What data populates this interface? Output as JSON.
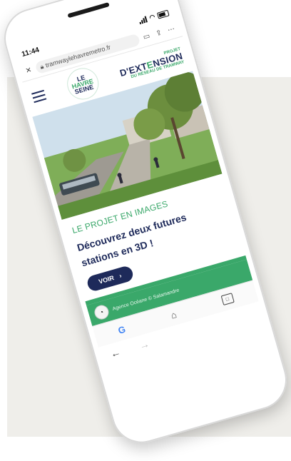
{
  "status": {
    "time": "11:44"
  },
  "browser": {
    "url": "tramwaylehavremetro.fr"
  },
  "site": {
    "logo_line1": "LE",
    "logo_line2": "HAVRE",
    "logo_line3": "SEINE",
    "projet_label": "PROJET",
    "extension_prefix": "D'EXT",
    "extension_accent": "E",
    "extension_suffix": "NSION",
    "reseau_label": "DU RÉSEAU DE TRAMWAY"
  },
  "card": {
    "kicker": "LE PROJET EN IMAGES",
    "headline": "Découvrez deux futures stations en 3D !",
    "button_label": "VOIR",
    "button_arrow": "›"
  },
  "footer": {
    "credit": "Agence Océane © Salamandre"
  },
  "icons": {
    "close": "close-icon",
    "lock": "lock-icon",
    "bookmark": "bookmark-icon",
    "share": "share-icon",
    "more": "more-icon",
    "menu": "hamburger-menu-icon",
    "cookie": "cookie-icon",
    "back": "back-arrow-icon",
    "forward": "forward-arrow-icon",
    "google": "google-icon",
    "home": "home-icon",
    "tabs": "tabs-icon"
  },
  "colors": {
    "navy": "#1e2a5a",
    "green": "#3aa86a",
    "panel": "#efeeea"
  }
}
